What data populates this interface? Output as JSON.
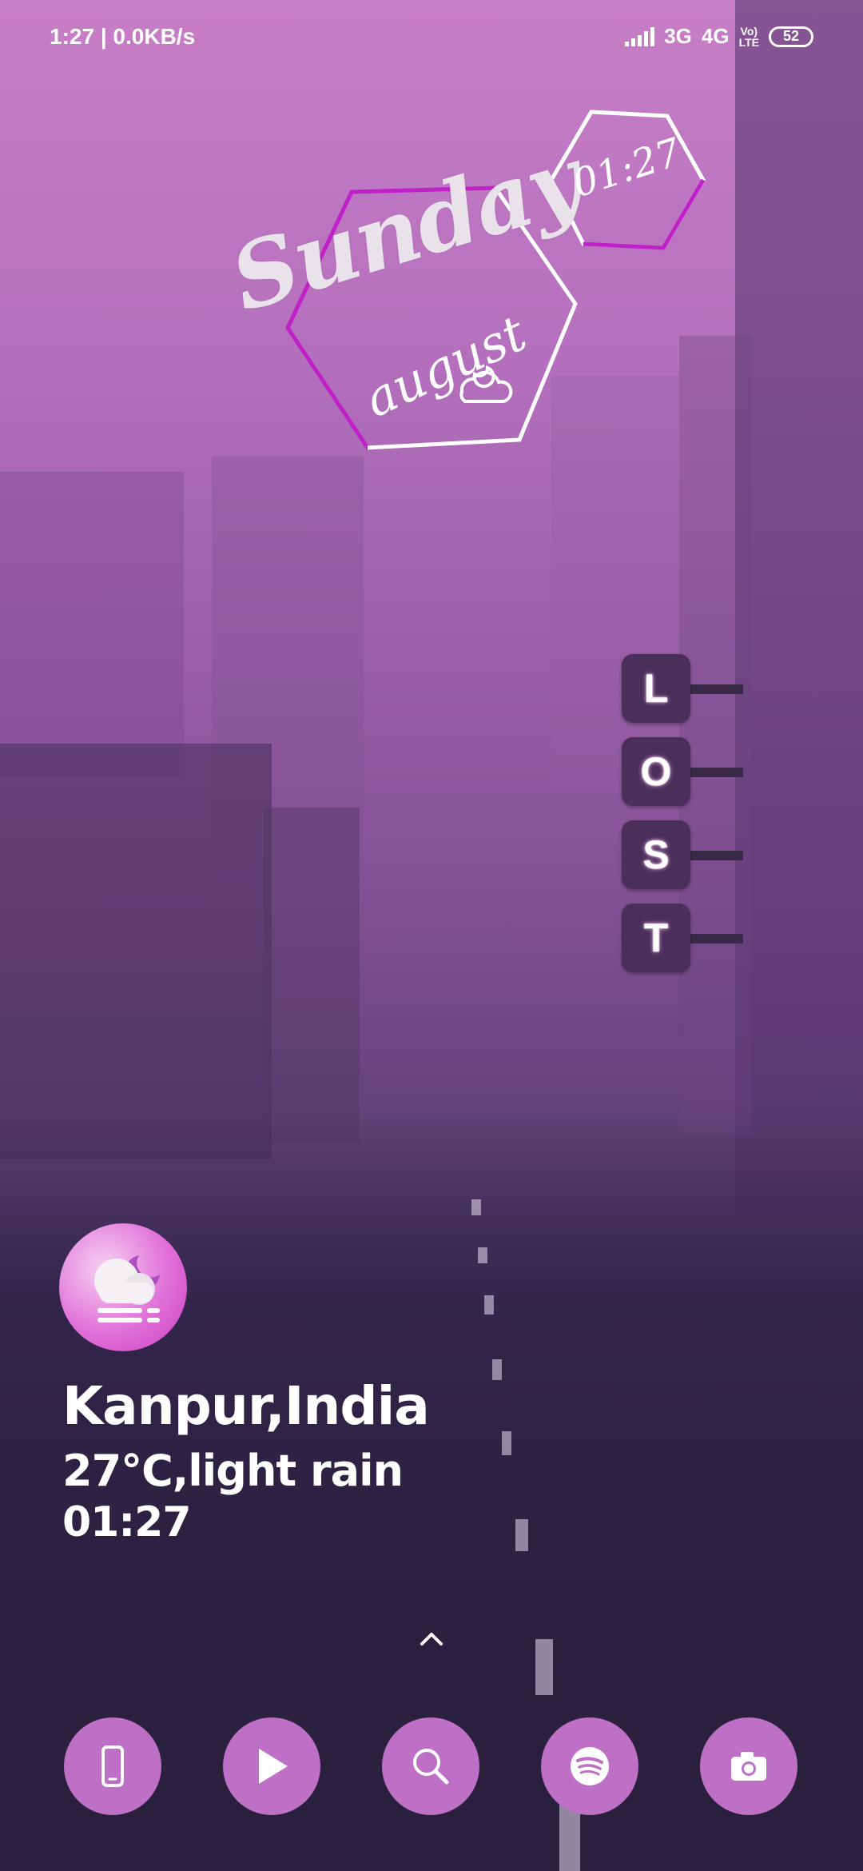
{
  "status_bar": {
    "time_speed": "1:27 | 0.0KB/s",
    "network_3g": "3G",
    "network_4g": "4G",
    "volte_line1": "Vo)",
    "volte_line2": "LTE",
    "battery": "52"
  },
  "clock_widget": {
    "day": "Sunday",
    "month": "august",
    "time": "01:27"
  },
  "lost_sign": {
    "letters": [
      "L",
      "O",
      "S",
      "T"
    ]
  },
  "weather": {
    "icon": "cloudy-night-fog-icon",
    "city": "Kanpur,India",
    "condition": "27°C,light rain",
    "time": "01:27"
  },
  "dock": {
    "apps": [
      "phone-icon",
      "play-store-icon",
      "search-icon",
      "spotify-icon",
      "camera-icon"
    ]
  },
  "colors": {
    "accent": "#be6fc6",
    "hex_outline_purple": "#c020c8",
    "sign_bg": "#4a2f5a"
  }
}
